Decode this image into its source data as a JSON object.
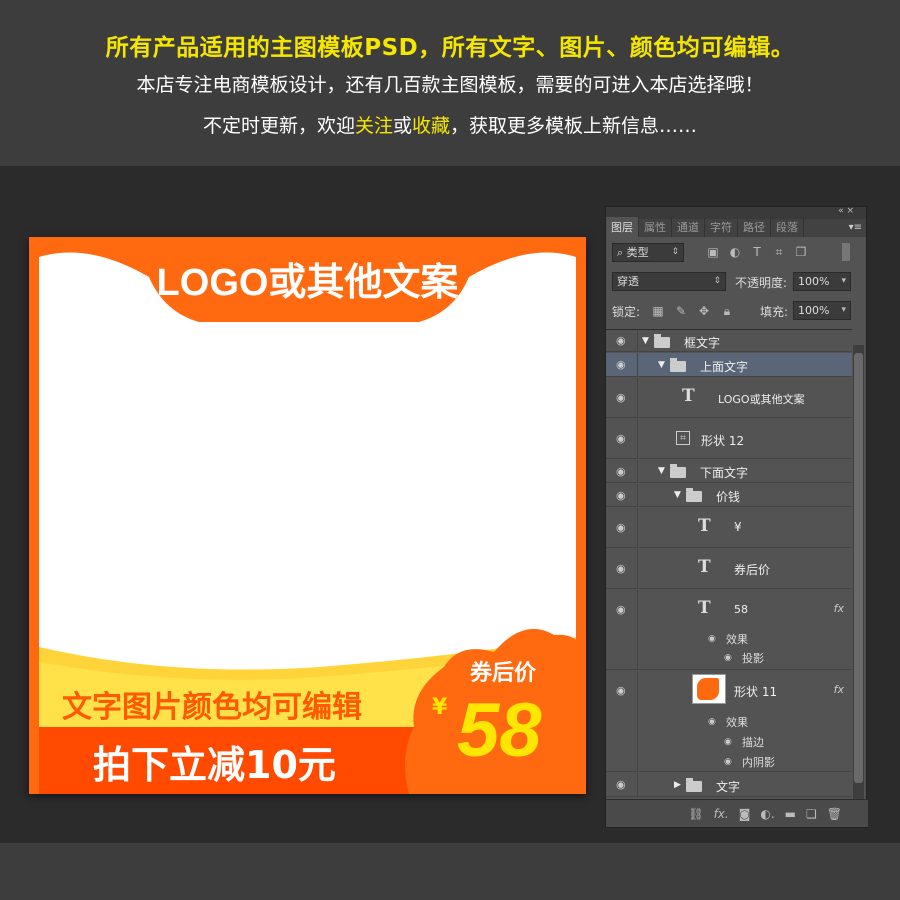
{
  "banner": {
    "line1": "所有产品适用的主图模板PSD，所有文字、图片、颜色均可编辑。",
    "line2": "本店专注电商模板设计，还有几百款主图模板，需要的可进入本店选择哦！",
    "line3_a": "不定时更新，欢迎",
    "line3_follow": "关注",
    "line3_or": "或",
    "line3_collect": "收藏",
    "line3_b": "，获取更多模板上新信息……"
  },
  "template": {
    "logo_text": "LOGO或其他文案",
    "editable_text": "文字图片颜色均可编辑",
    "discount_text": "拍下立减10元",
    "coupon_label": "券后价",
    "yen": "¥",
    "price": "58",
    "colors": {
      "orange": "#ff6a10",
      "yellow": "#ffe600",
      "deep_orange": "#ff4a00"
    }
  },
  "panel": {
    "tabs": [
      "图层",
      "属性",
      "通道",
      "字符",
      "路径",
      "段落"
    ],
    "filter_type": "类型",
    "blend_mode": "穿透",
    "opacity_label": "不透明度:",
    "opacity_value": "100%",
    "lock_label": "锁定:",
    "fill_label": "填充:",
    "fill_value": "100%",
    "layers": {
      "frame_text": "框文字",
      "top_text": "上面文字",
      "logo_layer": "LOGO或其他文案",
      "shape12": "形状 12",
      "bottom_text": "下面文字",
      "price_group": "价钱",
      "yen_layer": "¥",
      "coupon_layer": "券后价",
      "price_layer": "58",
      "effects1": "效果",
      "drop_shadow": "投影",
      "shape11": "形状 11",
      "effects2": "效果",
      "stroke": "描边",
      "inner_shadow": "内阴影",
      "text_group": "文字"
    },
    "fx": "fx"
  }
}
